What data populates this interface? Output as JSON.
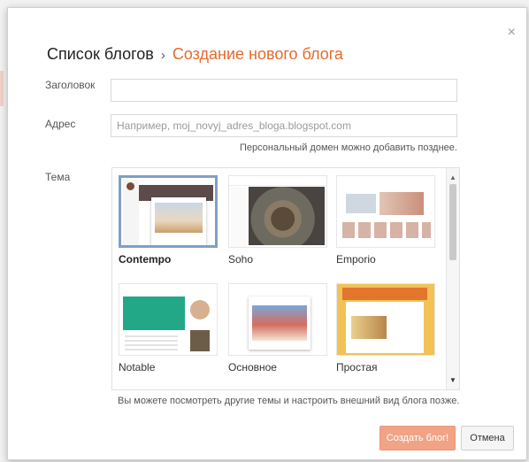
{
  "header": {
    "breadcrumb_parent": "Список блогов",
    "breadcrumb_separator": "›",
    "breadcrumb_current": "Создание нового блога",
    "close_glyph": "×"
  },
  "form": {
    "title_label": "Заголовок",
    "title_value": "",
    "address_label": "Адрес",
    "address_placeholder": "Например, moj_novyj_adres_bloga.blogspot.com",
    "address_hint": "Персональный домен можно добавить позднее.",
    "theme_label": "Тема"
  },
  "themes": [
    {
      "name": "Contempo",
      "selected": true
    },
    {
      "name": "Soho",
      "selected": false
    },
    {
      "name": "Emporio",
      "selected": false
    },
    {
      "name": "Notable",
      "selected": false
    },
    {
      "name": "Основное",
      "selected": false
    },
    {
      "name": "Простая",
      "selected": false
    }
  ],
  "themes_note": "Вы можете посмотреть другие темы и настроить внешний вид блога позже.",
  "buttons": {
    "create": "Создать блог!",
    "cancel": "Отмена"
  },
  "icons": {
    "close": "close-icon",
    "scroll_up": "scroll-up-arrow-icon",
    "scroll_down": "scroll-down-arrow-icon"
  },
  "colors": {
    "accent": "#e66a2c",
    "selected_border": "#7f9fc8",
    "primary_button": "#f1a386"
  }
}
